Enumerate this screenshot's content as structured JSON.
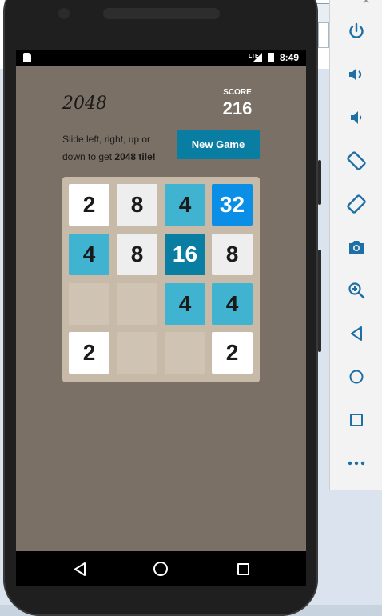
{
  "status_bar": {
    "network": "LTE",
    "time": "8:49"
  },
  "game": {
    "title": "2048",
    "score_label": "SCORE",
    "score_value": "216",
    "instructions_prefix": "Slide left, right, up or down to get ",
    "instructions_bold": "2048 tile!",
    "new_game_label": "New Game",
    "grid": [
      [
        2,
        8,
        4,
        32
      ],
      [
        4,
        8,
        16,
        8
      ],
      [
        null,
        null,
        4,
        4
      ],
      [
        2,
        null,
        null,
        2
      ]
    ]
  },
  "colors": {
    "screen_bg": "#7a7066",
    "board_bg": "#c7baa8",
    "empty_tile": "#cfc3b4",
    "tile_2": "#ffffff",
    "tile_8": "#eeeeee",
    "tile_4": "#40b3d1",
    "tile_16": "#0a7da3",
    "tile_32": "#0b8fe6",
    "button": "#0a7da3"
  },
  "navigation": {
    "buttons": [
      "back-icon",
      "home-icon",
      "recents-icon"
    ]
  },
  "emulator_toolbar": {
    "icons": [
      "power-icon",
      "volume-up-icon",
      "volume-down-icon",
      "rotate-left-icon",
      "rotate-right-icon",
      "camera-icon",
      "zoom-in-icon",
      "back-icon",
      "home-icon",
      "overview-icon",
      "more-icon"
    ]
  }
}
